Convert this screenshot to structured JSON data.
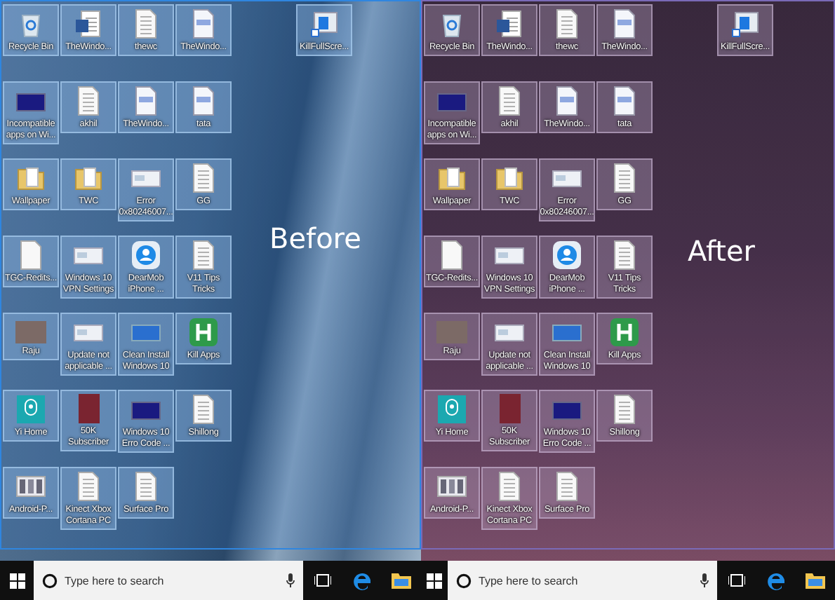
{
  "panels": [
    {
      "kind": "blue",
      "caption": "Before",
      "top_right_icons": [
        {
          "label": "KillFullScre...",
          "kind": "shortcut",
          "selected": true
        }
      ],
      "icon_rows": [
        [
          {
            "label": "Recycle Bin",
            "kind": "recycle",
            "selected": true
          },
          {
            "label": "TheWindo...",
            "kind": "word",
            "selected": true
          },
          {
            "label": "thewc",
            "kind": "doc",
            "selected": true
          },
          {
            "label": "TheWindo...",
            "kind": "pdf",
            "selected": true
          }
        ],
        [
          {
            "label": "Incompatible apps on Wi...",
            "kind": "dark-screen",
            "selected": true
          },
          {
            "label": "akhil",
            "kind": "doc",
            "selected": true
          },
          {
            "label": "TheWindo...",
            "kind": "pdf",
            "selected": true
          },
          {
            "label": "tata",
            "kind": "pdf",
            "selected": true
          }
        ],
        [
          {
            "label": "Wallpaper",
            "kind": "folder",
            "selected": true
          },
          {
            "label": "TWC",
            "kind": "folder",
            "selected": true
          },
          {
            "label": "Error 0x80246007...",
            "kind": "screen",
            "selected": true
          },
          {
            "label": "GG",
            "kind": "doc",
            "selected": true
          }
        ],
        [
          {
            "label": "TGC-Redits...",
            "kind": "blank",
            "selected": true
          },
          {
            "label": "Windows 10 VPN Settings",
            "kind": "screen",
            "selected": true
          },
          {
            "label": "DearMob iPhone ...",
            "kind": "person-app",
            "selected": true
          },
          {
            "label": "V11 Tips Tricks",
            "kind": "doc",
            "selected": true
          }
        ],
        [
          {
            "label": "Raju",
            "kind": "photo",
            "selected": true
          },
          {
            "label": "Update not applicable ...",
            "kind": "screen",
            "selected": true
          },
          {
            "label": "Clean Install Windows 10",
            "kind": "blue-screen",
            "selected": true
          },
          {
            "label": "Kill Apps",
            "kind": "h-app",
            "selected": true
          }
        ],
        [
          {
            "label": "Yi Home",
            "kind": "camera-app",
            "selected": true
          },
          {
            "label": "50K Subscriber",
            "kind": "cover",
            "selected": true
          },
          {
            "label": "Windows 10 Erro Code ...",
            "kind": "dark-screen",
            "selected": true
          },
          {
            "label": "Shillong",
            "kind": "doc",
            "selected": true
          }
        ],
        [
          {
            "label": "Android-P...",
            "kind": "phones",
            "selected": true
          },
          {
            "label": "Kinect Xbox Cortana PC",
            "kind": "doc",
            "selected": true
          },
          {
            "label": "Surface Pro",
            "kind": "doc",
            "selected": true
          }
        ]
      ],
      "search_placeholder": "Type here to search"
    },
    {
      "kind": "purple",
      "caption": "After",
      "top_right_icons": [
        {
          "label": "KillFullScre...",
          "kind": "shortcut",
          "selected": true
        }
      ],
      "icon_rows": [
        [
          {
            "label": "Recycle Bin",
            "kind": "recycle",
            "selected": true
          },
          {
            "label": "TheWindo...",
            "kind": "word",
            "selected": true
          },
          {
            "label": "thewc",
            "kind": "doc",
            "selected": true
          },
          {
            "label": "TheWindo...",
            "kind": "pdf",
            "selected": true
          }
        ],
        [
          {
            "label": "Incompatible apps on Wi...",
            "kind": "dark-screen",
            "selected": true
          },
          {
            "label": "akhil",
            "kind": "doc",
            "selected": true
          },
          {
            "label": "TheWindo...",
            "kind": "pdf",
            "selected": true
          },
          {
            "label": "tata",
            "kind": "pdf",
            "selected": true
          }
        ],
        [
          {
            "label": "Wallpaper",
            "kind": "folder",
            "selected": true
          },
          {
            "label": "TWC",
            "kind": "folder",
            "selected": true
          },
          {
            "label": "Error 0x80246007...",
            "kind": "screen",
            "selected": true
          },
          {
            "label": "GG",
            "kind": "doc",
            "selected": true
          }
        ],
        [
          {
            "label": "TGC-Redits...",
            "kind": "blank",
            "selected": true
          },
          {
            "label": "Windows 10 VPN Settings",
            "kind": "screen",
            "selected": true
          },
          {
            "label": "DearMob iPhone ...",
            "kind": "person-app",
            "selected": true
          },
          {
            "label": "V11 Tips Tricks",
            "kind": "doc",
            "selected": true
          }
        ],
        [
          {
            "label": "Raju",
            "kind": "photo",
            "selected": true
          },
          {
            "label": "Update not applicable ...",
            "kind": "screen",
            "selected": true
          },
          {
            "label": "Clean Install Windows 10",
            "kind": "blue-screen",
            "selected": true
          },
          {
            "label": "Kill Apps",
            "kind": "h-app",
            "selected": true
          }
        ],
        [
          {
            "label": "Yi Home",
            "kind": "camera-app",
            "selected": true
          },
          {
            "label": "50K Subscriber",
            "kind": "cover",
            "selected": true
          },
          {
            "label": "Windows 10 Erro Code ...",
            "kind": "dark-screen",
            "selected": true
          },
          {
            "label": "Shillong",
            "kind": "doc",
            "selected": true
          }
        ],
        [
          {
            "label": "Android-P...",
            "kind": "phones",
            "selected": true
          },
          {
            "label": "Kinect Xbox Cortana PC",
            "kind": "doc",
            "selected": true
          },
          {
            "label": "Surface Pro",
            "kind": "doc",
            "selected": true
          }
        ]
      ],
      "search_placeholder": "Type here to search"
    }
  ]
}
